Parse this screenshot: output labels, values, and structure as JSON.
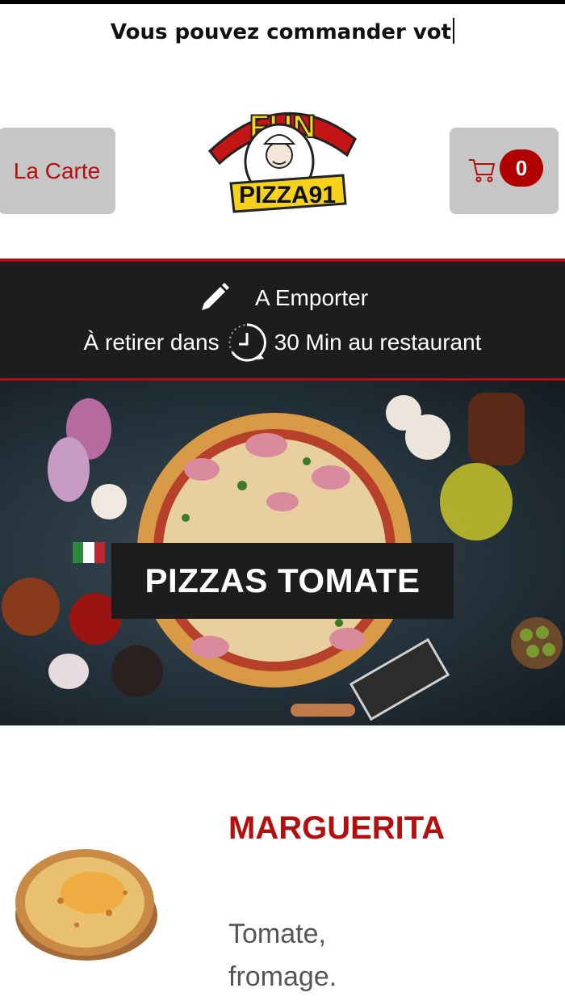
{
  "ticker": {
    "text": "Vous pouvez commander vot"
  },
  "header": {
    "menu_label": "La Carte",
    "cart_count": "0",
    "logo_text_top": "FUN",
    "logo_text_bottom": "PIZZA91"
  },
  "order_info": {
    "mode": "A Emporter",
    "pickup_prefix": "À retirer dans",
    "pickup_time": "30 Min au restaurant"
  },
  "category": {
    "title": "PIZZAS TOMATE"
  },
  "product": {
    "name": "MARGUERITA",
    "description": "Tomate, fromage."
  },
  "colors": {
    "accent": "#b30f0f",
    "dark_band": "#1d1d1d",
    "button_gray": "#c6c6c6"
  }
}
